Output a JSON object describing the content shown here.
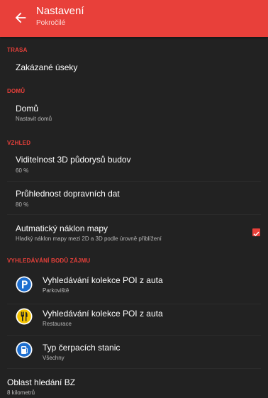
{
  "appbar": {
    "title": "Nastavení",
    "subtitle": "Pokročilé"
  },
  "sections": {
    "trasa": {
      "header": "TRASA",
      "items": [
        {
          "title": "Zakázané úseky"
        }
      ]
    },
    "domu": {
      "header": "DOMŮ",
      "items": [
        {
          "title": "Domů",
          "subtitle": "Nastavit domů"
        }
      ]
    },
    "vzhled": {
      "header": "VZHLED",
      "items": [
        {
          "title": "Viditelnost 3D půdorysů budov",
          "subtitle": "60 %"
        },
        {
          "title": "Průhlednost dopravních dat",
          "subtitle": "80 %"
        },
        {
          "title": "Autmatický náklon mapy",
          "subtitle": "Hladký náklon mapy mezi 2D a 3D podle úrovně přiblížení",
          "checked": true
        }
      ]
    },
    "poi": {
      "header": "VYHLEDÁVÁNÍ BODŮ ZÁJMU",
      "items": [
        {
          "title": "Vyhledávání kolekce POI z auta",
          "subtitle": "Parkoviště",
          "icon": "parking-icon",
          "icon_color": "#1e6fd0"
        },
        {
          "title": "Vyhledávání kolekce POI z auta",
          "subtitle": "Restaurace",
          "icon": "restaurant-icon",
          "icon_color": "#f5c400"
        },
        {
          "title": "Typ čerpacích stanic",
          "subtitle": "Všechny",
          "icon": "fuel-station-icon",
          "icon_color": "#1e6fd0"
        },
        {
          "title": "Oblast hledání BZ",
          "subtitle": "8 kilometrů"
        }
      ]
    }
  },
  "colors": {
    "accent": "#e8403a",
    "background": "#222222"
  }
}
